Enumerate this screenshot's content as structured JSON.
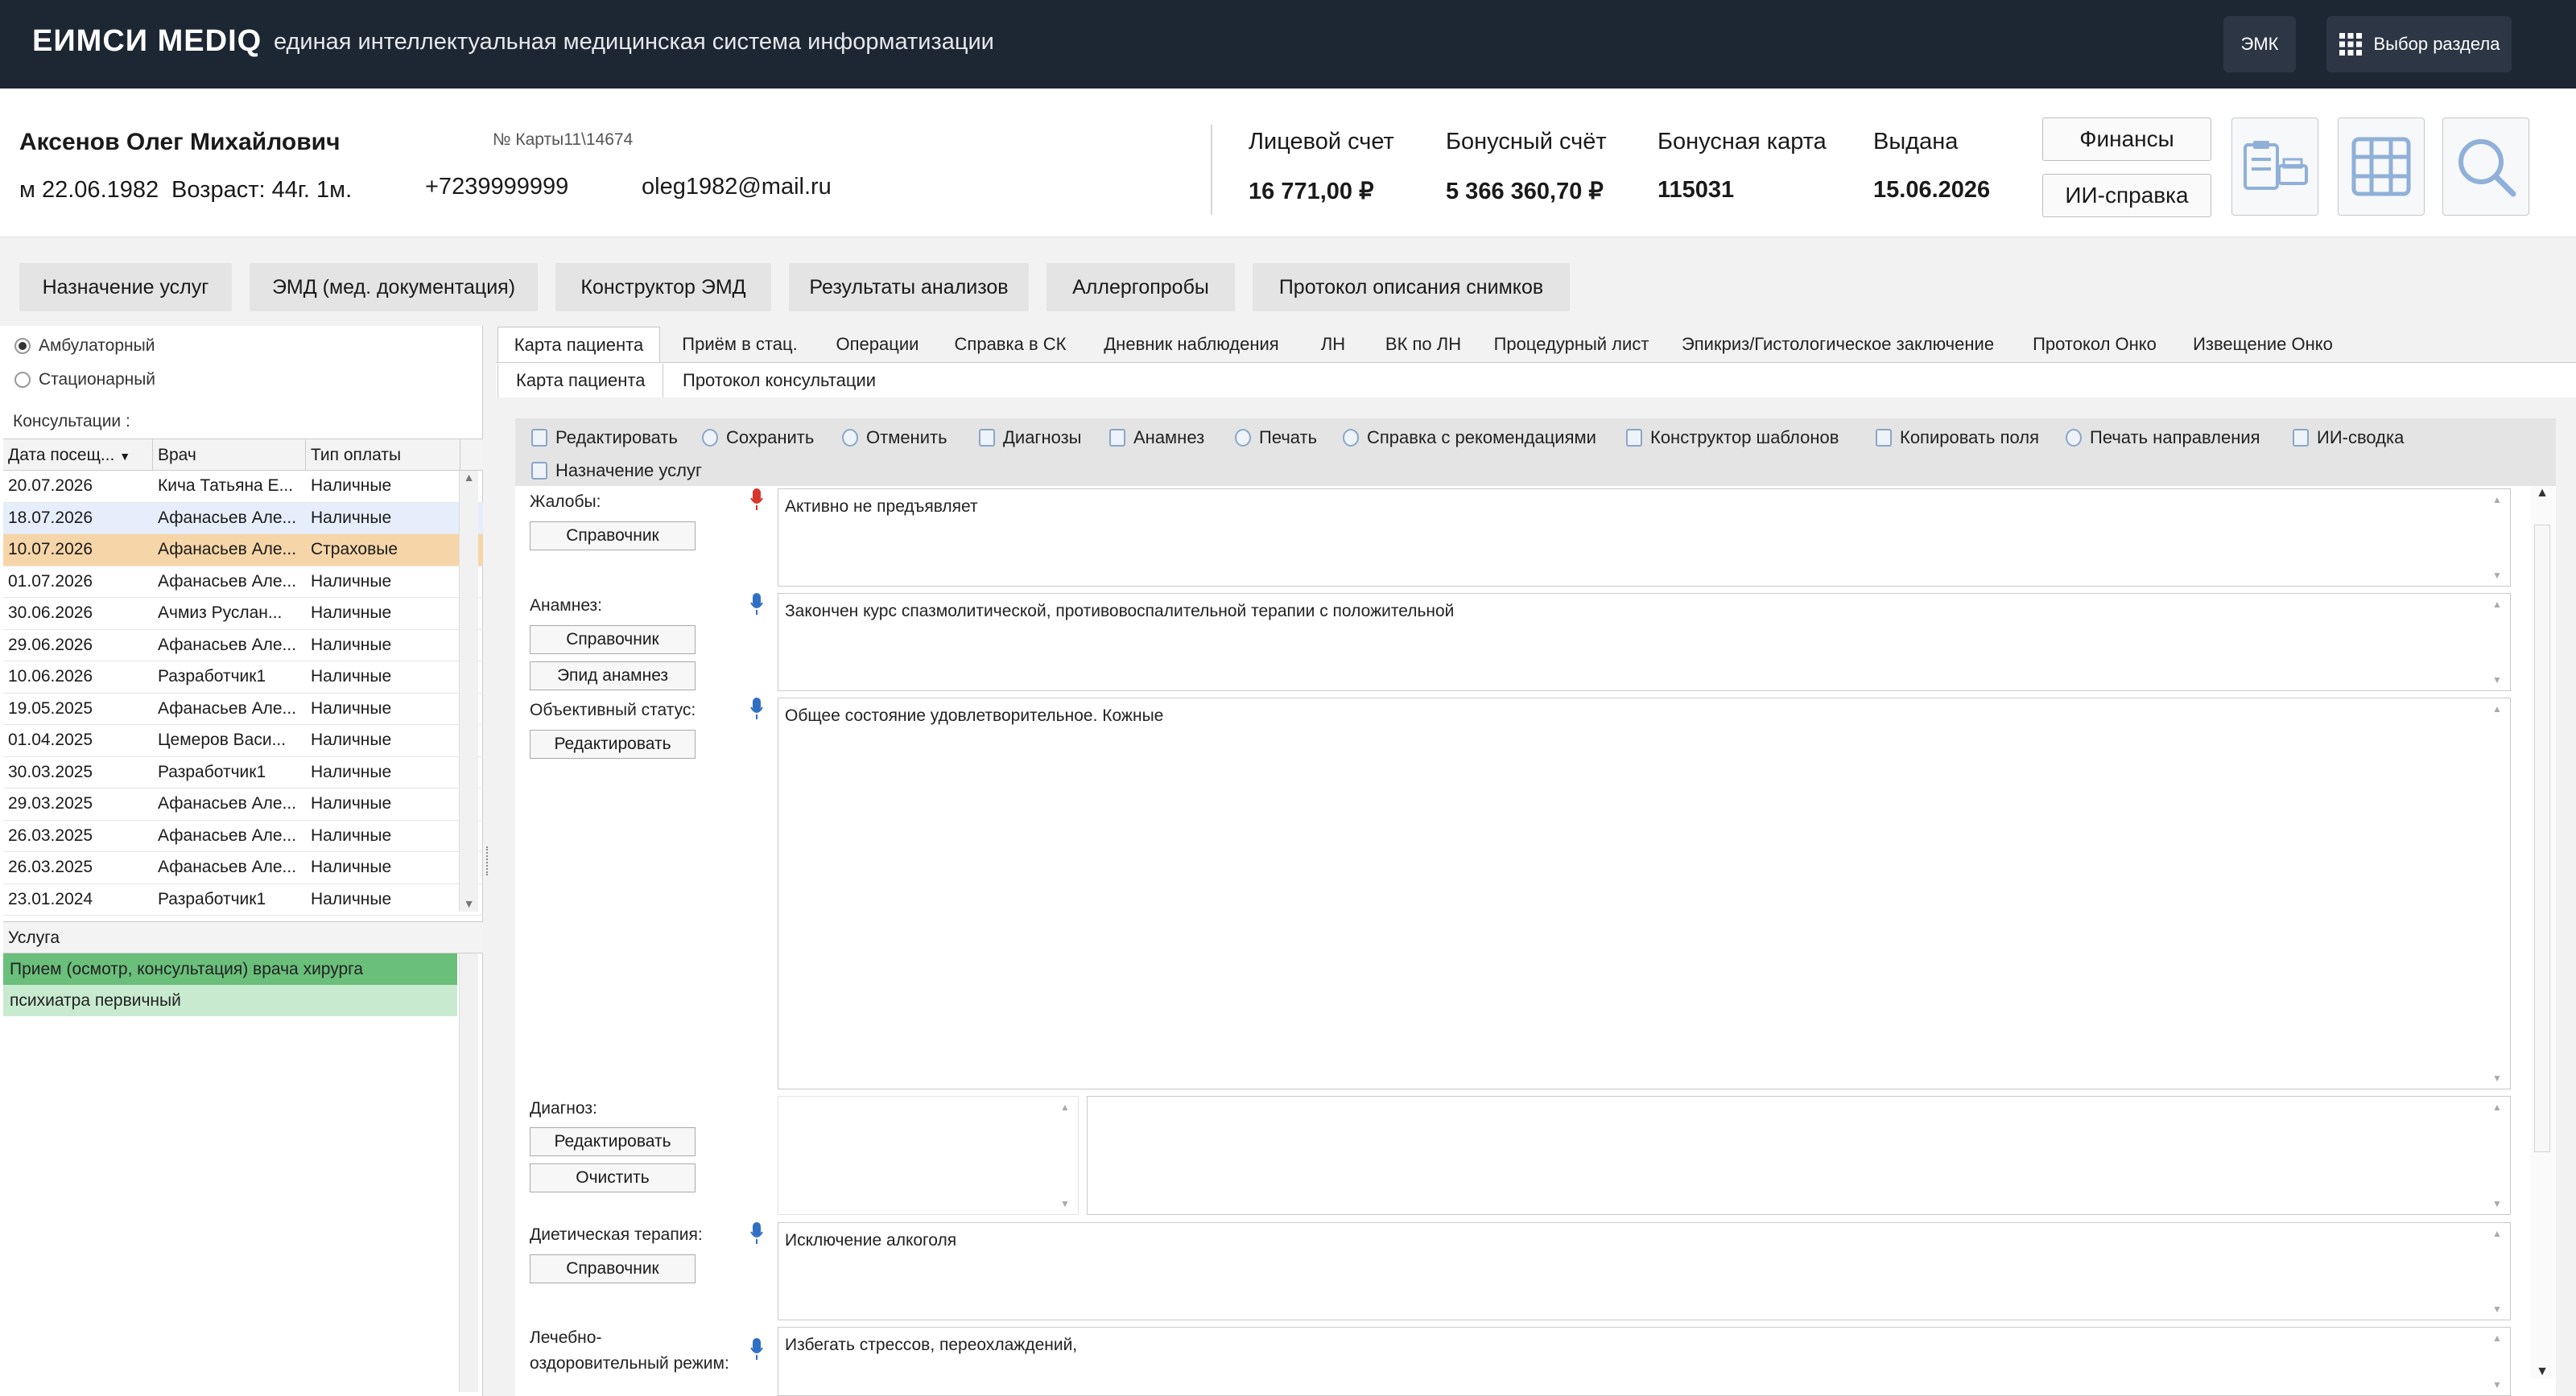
{
  "header": {
    "brand": "ЕИМСИ MEDIQ",
    "subtitle": "единая интеллектуальная медицинская система информатизации",
    "emk_label": "ЭМК",
    "section_label": "Выбор раздела"
  },
  "patient": {
    "name": "Аксенов Олег Михайлович",
    "card": "№ Карты11\\14674",
    "sex_dob": "м 22.06.1982",
    "age": "Возраст: 44г. 1м.",
    "phone": "+7239999999",
    "email": "oleg1982@mail.ru"
  },
  "finance": {
    "account_label": "Лицевой счет",
    "account_value": "16 771,00 ₽",
    "bonus_label": "Бонусный счёт",
    "bonus_value": "5 366 360,70 ₽",
    "card_label": "Бонусная карта",
    "card_value": "115031",
    "issued_label": "Выдана",
    "issued_value": "15.06.2026",
    "finances_btn": "Финансы",
    "ai_btn": "ИИ-справка"
  },
  "section_tabs": [
    "Назначение услуг",
    "ЭМД (мед. документация)",
    "Конструктор ЭМД",
    "Результаты анализов",
    "Аллергопробы",
    "Протокол описания снимков"
  ],
  "left": {
    "radio_amb": "Амбулаторный",
    "radio_stat": "Стационарный",
    "consult_label": "Консультации :",
    "columns": [
      "Дата посещ...",
      "Врач",
      "Тип оплаты"
    ],
    "rows": [
      [
        "20.07.2026",
        "Кича Татьяна Е...",
        "Наличные"
      ],
      [
        "18.07.2026",
        "Афанасьев Але...",
        "Наличные"
      ],
      [
        "10.07.2026",
        "Афанасьев Але...",
        "Страховые"
      ],
      [
        "01.07.2026",
        "Афанасьев Але...",
        "Наличные"
      ],
      [
        "30.06.2026",
        "Ачмиз Руслан...",
        "Наличные"
      ],
      [
        "29.06.2026",
        "Афанасьев Але...",
        "Наличные"
      ],
      [
        "10.06.2026",
        "Разработчик1",
        "Наличные"
      ],
      [
        "19.05.2025",
        "Афанасьев Але...",
        "Наличные"
      ],
      [
        "01.04.2025",
        "Цемеров Васи...",
        "Наличные"
      ],
      [
        "30.03.2025",
        "Разработчик1",
        "Наличные"
      ],
      [
        "29.03.2025",
        "Афанасьев Але...",
        "Наличные"
      ],
      [
        "26.03.2025",
        "Афанасьев Але...",
        "Наличные"
      ],
      [
        "26.03.2025",
        "Афанасьев Але...",
        "Наличные"
      ],
      [
        "23.01.2024",
        "Разработчик1",
        "Наличные"
      ]
    ],
    "service_header": "Услуга",
    "services": [
      "Прием (осмотр, консультация) врача хирурга",
      "психиатра первичный"
    ]
  },
  "main_tabs": [
    "Карта пациента",
    "Приём в стац.",
    "Операции",
    "Справка в СК",
    "Дневник наблюдения",
    "ЛН",
    "ВК по ЛН",
    "Процедурный лист",
    "Эпикриз/Гистологическое заключение",
    "Протокол Онко",
    "Извещение Онко"
  ],
  "sub_tabs": [
    "Карта пациента",
    "Протокол консультации"
  ],
  "toolbar": [
    "Редактировать",
    "Сохранить",
    "Отменить",
    "Диагнозы",
    "Анамнез",
    "Печать",
    "Справка с рекомендациями",
    "Конструктор шаблонов",
    "Копировать поля",
    "Печать направления",
    "ИИ-сводка"
  ],
  "toolbar2": "Назначение услуг",
  "form": {
    "complaints_label": "Жалобы:",
    "complaints_text": "Активно не предъявляет",
    "ref": "Справочник",
    "anamnesis_label": "Анамнез:",
    "anamnesis_text": "Закончен курс спазмолитической, противовоспалительной терапии с положительной",
    "epid": "Эпид анамнез",
    "status_label": "Объективный статус:",
    "status_text": "Общее состояние удовлетворительное. Кожные",
    "edit": "Редактировать",
    "diag_label": "Диагноз:",
    "clear": "Очистить",
    "diet_label": "Диетическая терапия:",
    "diet_text": "Исключение алкоголя",
    "regime_label1": "Лечебно-",
    "regime_label2": "оздоровительный режим:",
    "regime_text": "Избегать стрессов, переохлаждений,"
  }
}
